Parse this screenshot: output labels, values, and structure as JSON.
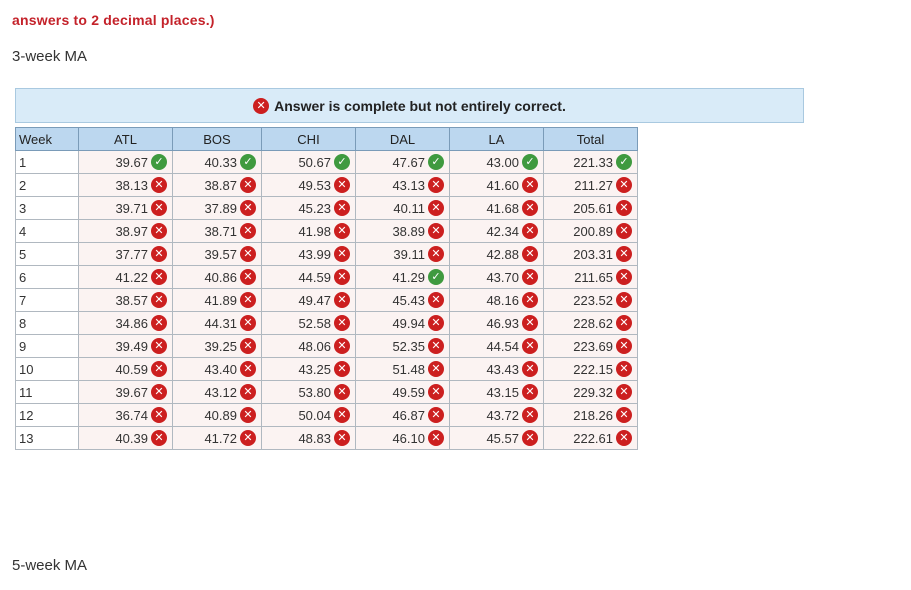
{
  "instruction": "answers to 2 decimal places.)",
  "section1_label": "3-week MA",
  "section2_label": "5-week MA",
  "banner_text": "Answer is complete but not entirely correct.",
  "table": {
    "headers": [
      "Week",
      "ATL",
      "BOS",
      "CHI",
      "DAL",
      "LA",
      "Total"
    ],
    "rows": [
      {
        "week": "1",
        "cells": [
          [
            "39.67",
            true
          ],
          [
            "40.33",
            true
          ],
          [
            "50.67",
            true
          ],
          [
            "47.67",
            true
          ],
          [
            "43.00",
            true
          ],
          [
            "221.33",
            true
          ]
        ]
      },
      {
        "week": "2",
        "cells": [
          [
            "38.13",
            false
          ],
          [
            "38.87",
            false
          ],
          [
            "49.53",
            false
          ],
          [
            "43.13",
            false
          ],
          [
            "41.60",
            false
          ],
          [
            "211.27",
            false
          ]
        ]
      },
      {
        "week": "3",
        "cells": [
          [
            "39.71",
            false
          ],
          [
            "37.89",
            false
          ],
          [
            "45.23",
            false
          ],
          [
            "40.11",
            false
          ],
          [
            "41.68",
            false
          ],
          [
            "205.61",
            false
          ]
        ]
      },
      {
        "week": "4",
        "cells": [
          [
            "38.97",
            false
          ],
          [
            "38.71",
            false
          ],
          [
            "41.98",
            false
          ],
          [
            "38.89",
            false
          ],
          [
            "42.34",
            false
          ],
          [
            "200.89",
            false
          ]
        ]
      },
      {
        "week": "5",
        "cells": [
          [
            "37.77",
            false
          ],
          [
            "39.57",
            false
          ],
          [
            "43.99",
            false
          ],
          [
            "39.11",
            false
          ],
          [
            "42.88",
            false
          ],
          [
            "203.31",
            false
          ]
        ]
      },
      {
        "week": "6",
        "cells": [
          [
            "41.22",
            false
          ],
          [
            "40.86",
            false
          ],
          [
            "44.59",
            false
          ],
          [
            "41.29",
            true
          ],
          [
            "43.70",
            false
          ],
          [
            "211.65",
            false
          ]
        ]
      },
      {
        "week": "7",
        "cells": [
          [
            "38.57",
            false
          ],
          [
            "41.89",
            false
          ],
          [
            "49.47",
            false
          ],
          [
            "45.43",
            false
          ],
          [
            "48.16",
            false
          ],
          [
            "223.52",
            false
          ]
        ]
      },
      {
        "week": "8",
        "cells": [
          [
            "34.86",
            false
          ],
          [
            "44.31",
            false
          ],
          [
            "52.58",
            false
          ],
          [
            "49.94",
            false
          ],
          [
            "46.93",
            false
          ],
          [
            "228.62",
            false
          ]
        ]
      },
      {
        "week": "9",
        "cells": [
          [
            "39.49",
            false
          ],
          [
            "39.25",
            false
          ],
          [
            "48.06",
            false
          ],
          [
            "52.35",
            false
          ],
          [
            "44.54",
            false
          ],
          [
            "223.69",
            false
          ]
        ]
      },
      {
        "week": "10",
        "cells": [
          [
            "40.59",
            false
          ],
          [
            "43.40",
            false
          ],
          [
            "43.25",
            false
          ],
          [
            "51.48",
            false
          ],
          [
            "43.43",
            false
          ],
          [
            "222.15",
            false
          ]
        ]
      },
      {
        "week": "11",
        "cells": [
          [
            "39.67",
            false
          ],
          [
            "43.12",
            false
          ],
          [
            "53.80",
            false
          ],
          [
            "49.59",
            false
          ],
          [
            "43.15",
            false
          ],
          [
            "229.32",
            false
          ]
        ]
      },
      {
        "week": "12",
        "cells": [
          [
            "36.74",
            false
          ],
          [
            "40.89",
            false
          ],
          [
            "50.04",
            false
          ],
          [
            "46.87",
            false
          ],
          [
            "43.72",
            false
          ],
          [
            "218.26",
            false
          ]
        ]
      },
      {
        "week": "13",
        "cells": [
          [
            "40.39",
            false
          ],
          [
            "41.72",
            false
          ],
          [
            "48.83",
            false
          ],
          [
            "46.10",
            false
          ],
          [
            "45.57",
            false
          ],
          [
            "222.61",
            false
          ]
        ]
      }
    ]
  },
  "colors": {
    "correct": "#3f9a3f",
    "incorrect": "#cc1f1f",
    "instruction_red": "#c4222a",
    "header_blue": "#bcd7ef",
    "banner_blue": "#d9ebf8"
  },
  "icons": {
    "correct": "check-circle-icon",
    "incorrect": "x-circle-icon"
  }
}
